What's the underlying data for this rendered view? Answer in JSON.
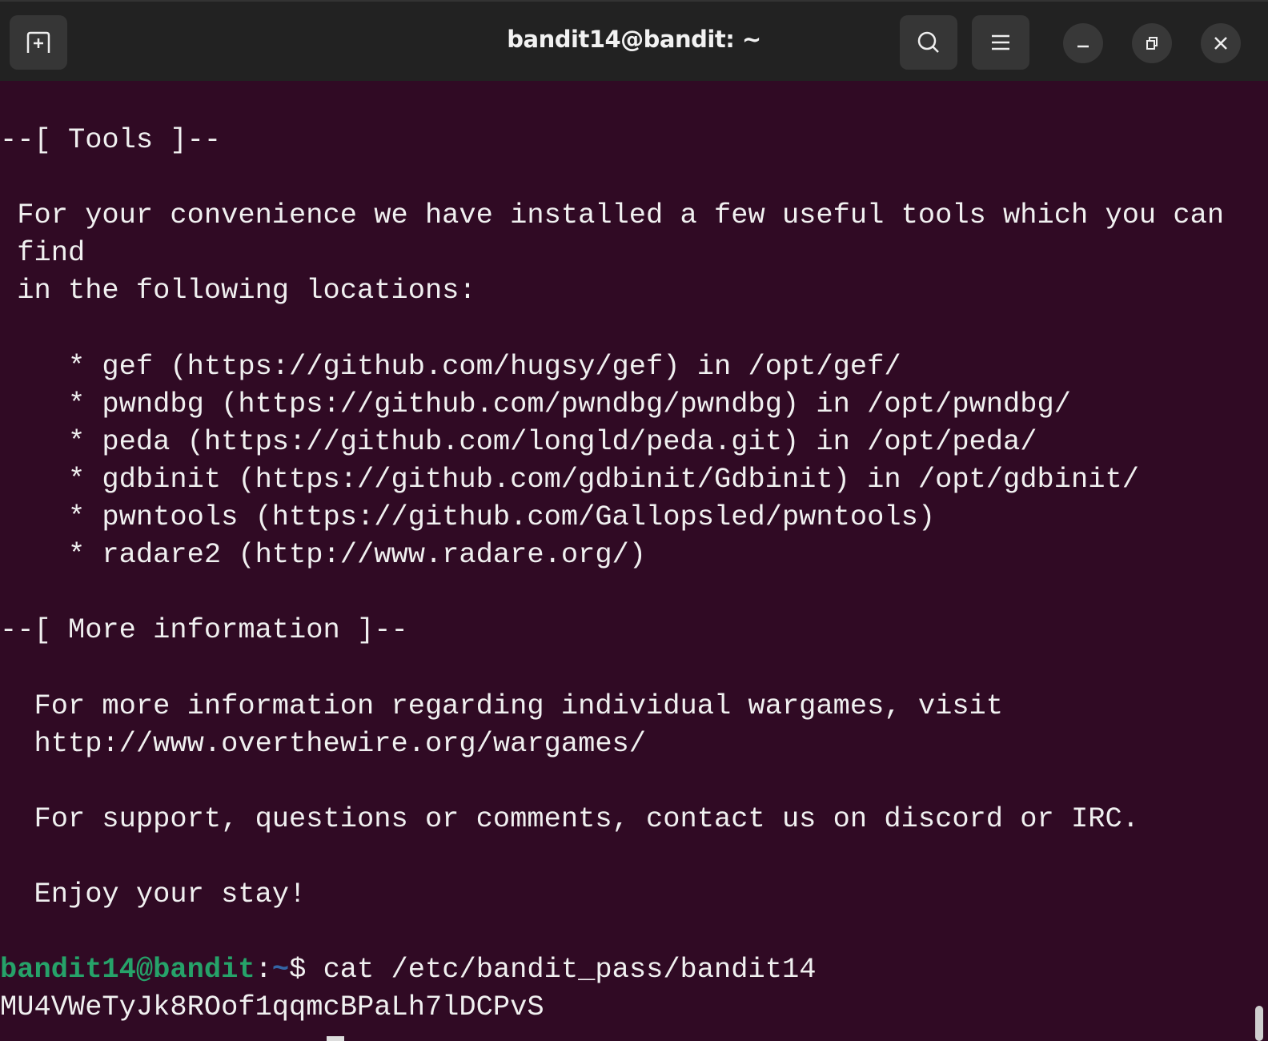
{
  "window": {
    "title": "bandit14@bandit: ~",
    "icons": [
      "new-tab-icon",
      "search-icon",
      "hamburger-menu-icon",
      "minimize-icon",
      "restore-icon",
      "close-icon"
    ]
  },
  "terminal": {
    "lines": [
      "",
      "--[ Tools ]--",
      "",
      " For your convenience we have installed a few useful tools which you can",
      " find",
      " in the following locations:",
      "",
      "    * gef (https://github.com/hugsy/gef) in /opt/gef/",
      "    * pwndbg (https://github.com/pwndbg/pwndbg) in /opt/pwndbg/",
      "    * peda (https://github.com/longld/peda.git) in /opt/peda/",
      "    * gdbinit (https://github.com/gdbinit/Gdbinit) in /opt/gdbinit/",
      "    * pwntools (https://github.com/Gallopsled/pwntools)",
      "    * radare2 (http://www.radare.org/)",
      "",
      "--[ More information ]--",
      "",
      "  For more information regarding individual wargames, visit",
      "  http://www.overthewire.org/wargames/",
      "",
      "  For support, questions or comments, contact us on discord or IRC.",
      "",
      "  Enjoy your stay!",
      ""
    ],
    "prompt": {
      "user_host": "bandit14@bandit",
      "colon": ":",
      "path": "~",
      "symbol": "$ ",
      "command": "cat /etc/bandit_pass/bandit14"
    },
    "output": "MU4VWeTyJk8ROof1qqmcBPaLh7lDCPvS"
  },
  "colors": {
    "background": "#300a24",
    "prompt_user": "#26a269",
    "prompt_path": "#3465a4",
    "titlebar": "#222222"
  }
}
